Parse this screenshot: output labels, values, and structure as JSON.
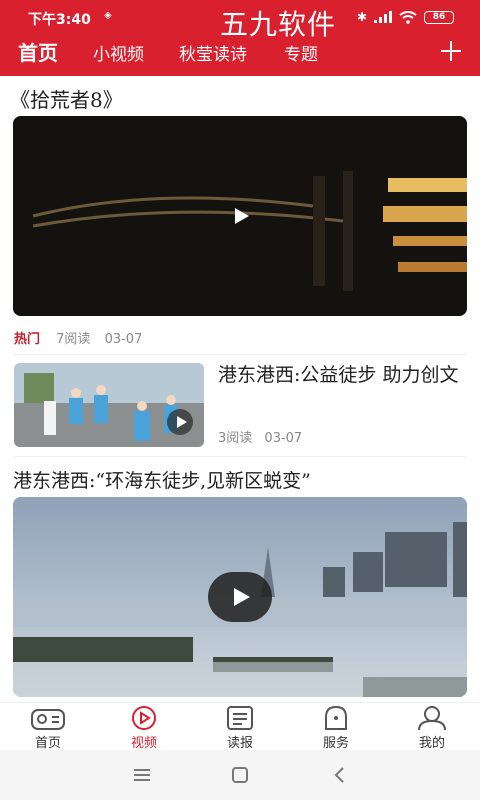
{
  "status_bar": {
    "time": "下午3:40",
    "watermark": "五九软件",
    "battery": "86"
  },
  "header": {
    "tabs": [
      {
        "label": "首页",
        "active": true
      },
      {
        "label": "小视频",
        "active": false
      },
      {
        "label": "秋莹读诗",
        "active": false
      },
      {
        "label": "专题",
        "active": false
      }
    ],
    "add_icon": "plus-icon",
    "accent_color": "#d9202e"
  },
  "feed": {
    "item1": {
      "title": "《拾荒者8》",
      "badge": "热门",
      "reads": "7阅读",
      "date": "03-07"
    },
    "item2": {
      "title": "港东港西:公益徒步 助力创文",
      "reads": "3阅读",
      "date": "03-07"
    },
    "item3": {
      "title": "港东港西:“环海东徒步,见新区蜕变”"
    }
  },
  "bottom_nav": {
    "items": [
      {
        "label": "首页",
        "icon": "radio-icon",
        "active": false
      },
      {
        "label": "视频",
        "icon": "play-circle-icon",
        "active": true
      },
      {
        "label": "读报",
        "icon": "newspaper-icon",
        "active": false
      },
      {
        "label": "服务",
        "icon": "service-icon",
        "active": false
      },
      {
        "label": "我的",
        "icon": "user-icon",
        "active": false
      }
    ]
  },
  "system_nav": {
    "icons": [
      "menu-icon",
      "home-icon",
      "back-icon"
    ]
  }
}
